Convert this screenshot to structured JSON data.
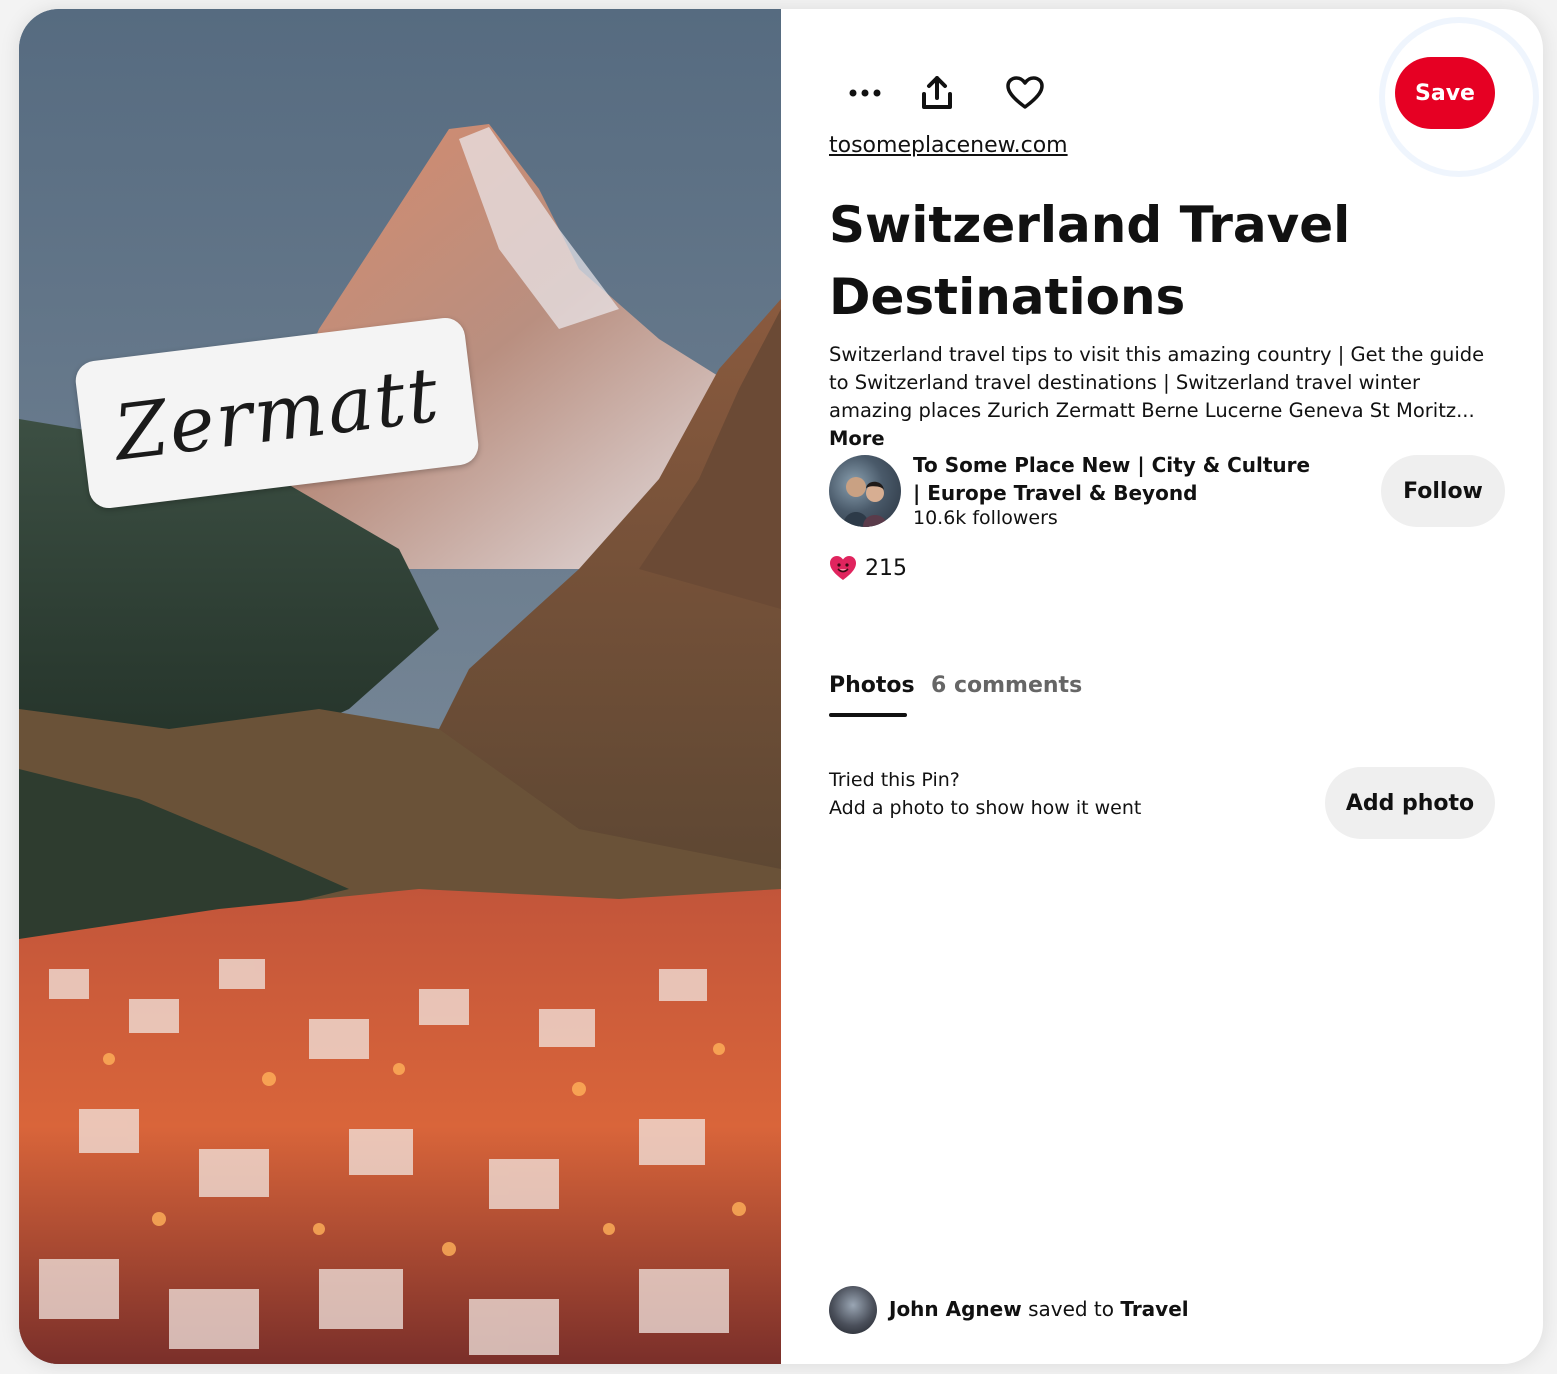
{
  "image": {
    "overlay_text": "Zermatt",
    "alt": "Matterhorn above Zermatt village"
  },
  "toolbar": {
    "more_icon": "more-horizontal-icon",
    "share_icon": "share-upload-icon",
    "like_icon": "heart-outline-icon",
    "save_label": "Save"
  },
  "pin": {
    "source": "tosomeplacenew.com",
    "title": "Switzerland Travel Destinations",
    "description": "Switzerland travel tips to visit this amazing country | Get the guide to Switzerland travel destinations | Switzerland travel winter amazing places Zurich Zermatt Berne Lucerne Geneva St Moritz...",
    "more_label": "More"
  },
  "creator": {
    "name": "To Some Place New | City & Culture | Europe Travel & Beyond",
    "followers": "10.6k followers",
    "follow_label": "Follow"
  },
  "reactions": {
    "icon": "heart-face-emoji",
    "count": "215"
  },
  "tabs": [
    {
      "label": "Photos",
      "active": true
    },
    {
      "label": "6 comments",
      "active": false
    }
  ],
  "tried": {
    "title": "Tried this Pin?",
    "subtitle": "Add a photo to show how it went",
    "button_label": "Add photo"
  },
  "saved_by": {
    "user": "John Agnew",
    "verb": "saved to",
    "board": "Travel"
  },
  "colors": {
    "save_red": "#e60023",
    "button_gray": "#efefef",
    "text": "#111111",
    "muted": "#666666"
  }
}
